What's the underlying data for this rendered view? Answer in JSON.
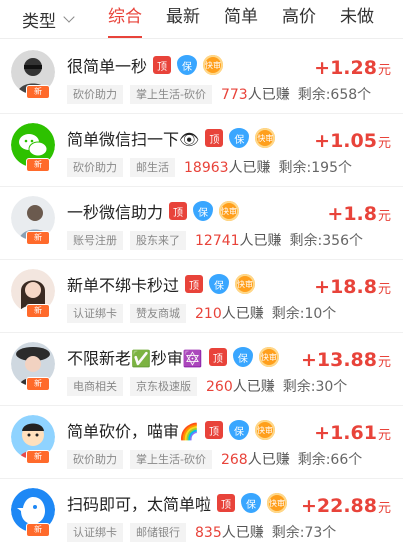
{
  "header": {
    "type_filter": "类型",
    "tabs": [
      "综合",
      "最新",
      "简单",
      "高价",
      "未做"
    ],
    "active_tab": "综合"
  },
  "badges": {
    "ding": "顶",
    "bao": "保",
    "kuai": "快审"
  },
  "new_badge": "新",
  "tasks": [
    {
      "title": "很简单一秒",
      "tags": [
        "砍价助力",
        "掌上生活-砍价"
      ],
      "earned": "773",
      "earned_suffix": "人已赚",
      "remain": "剩余:658个",
      "price": "+1.28",
      "unit": "元"
    },
    {
      "title": "简单微信扫一下👁",
      "tags": [
        "砍价助力",
        "邮生活"
      ],
      "earned": "18963",
      "earned_suffix": "人已赚",
      "remain": "剩余:195个",
      "price": "+1.05",
      "unit": "元"
    },
    {
      "title": "一秒微信助力",
      "tags": [
        "账号注册",
        "股东来了"
      ],
      "earned": "12741",
      "earned_suffix": "人已赚",
      "remain": "剩余:356个",
      "price": "+1.8",
      "unit": "元"
    },
    {
      "title": "新单不绑卡秒过",
      "tags": [
        "认证绑卡",
        "赞友商城"
      ],
      "earned": "210",
      "earned_suffix": "人已赚",
      "remain": "剩余:10个",
      "price": "+18.8",
      "unit": "元"
    },
    {
      "title": "不限新老✅秒审🔯",
      "tags": [
        "电商相关",
        "京东极速版"
      ],
      "earned": "260",
      "earned_suffix": "人已赚",
      "remain": "剩余:30个",
      "price": "+13.88",
      "unit": "元"
    },
    {
      "title": "简单砍价，喵审🌈",
      "tags": [
        "砍价助力",
        "掌上生活-砍价"
      ],
      "earned": "268",
      "earned_suffix": "人已赚",
      "remain": "剩余:66个",
      "price": "+1.61",
      "unit": "元"
    },
    {
      "title": "扫码即可，太简单啦",
      "tags": [
        "认证绑卡",
        "邮储银行"
      ],
      "earned": "835",
      "earned_suffix": "人已赚",
      "remain": "剩余:73个",
      "price": "+22.88",
      "unit": "元"
    }
  ]
}
